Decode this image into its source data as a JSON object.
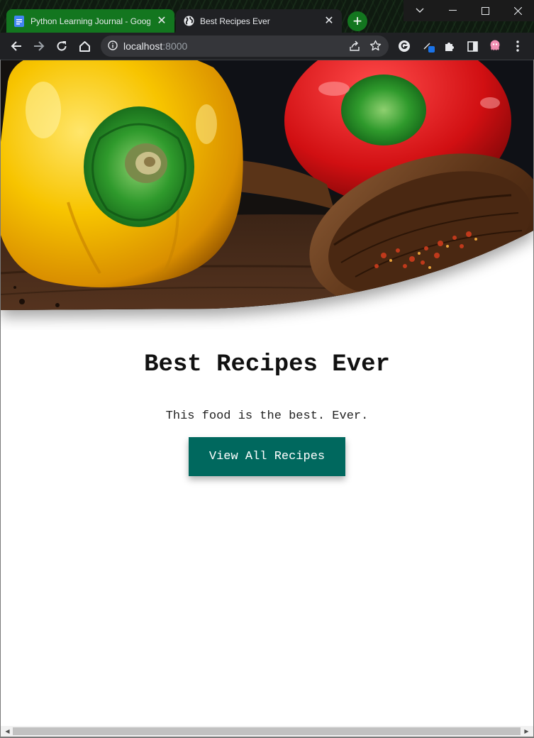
{
  "browser": {
    "tabs": [
      {
        "title": "Python Learning Journal - Google Docs",
        "icon": "google-docs-icon",
        "active": false
      },
      {
        "title": "Best Recipes Ever",
        "icon": "globe-icon",
        "active": true
      }
    ],
    "address": {
      "host": "localhost",
      "port": ":8000"
    },
    "colors": {
      "tab_strip_accent": "#13761f",
      "toolbar": "#202124",
      "omnibox": "#35363a"
    }
  },
  "page": {
    "hero_alt": "Yellow and red bell peppers with a wooden spoon of chili flakes",
    "title": "Best Recipes Ever",
    "tagline": "This food is the best. Ever.",
    "cta_label": "View All Recipes",
    "colors": {
      "cta": "#00685e",
      "cta_text": "#ffffff",
      "text": "#111111"
    }
  }
}
